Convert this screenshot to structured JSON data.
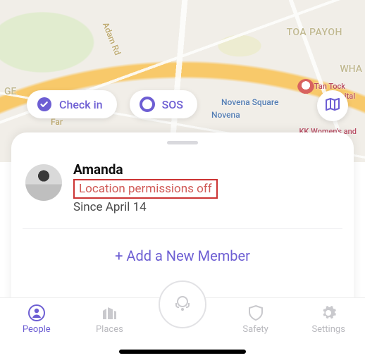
{
  "map": {
    "labels": {
      "adam_rd": "Adam Rd",
      "toa_payoh": "TOA PAYOH",
      "wha": "WHA",
      "ge": "GE",
      "novena": "Novena",
      "novena_square": "Novena Square",
      "tan_tock": "Tan Tock",
      "ital": "ital",
      "kk_womens": "KK Women's and",
      "farrer": "Far"
    }
  },
  "actions": {
    "checkin_label": "Check in",
    "sos_label": "SOS"
  },
  "member": {
    "name": "Amanda",
    "warning": "Location permissions off",
    "since": "Since April 14"
  },
  "add_member_label": "+ Add a New Member",
  "tabs": {
    "people": "People",
    "places": "Places",
    "safety": "Safety",
    "settings": "Settings"
  },
  "colors": {
    "accent": "#6d5ed3",
    "warning": "#d05a57"
  }
}
